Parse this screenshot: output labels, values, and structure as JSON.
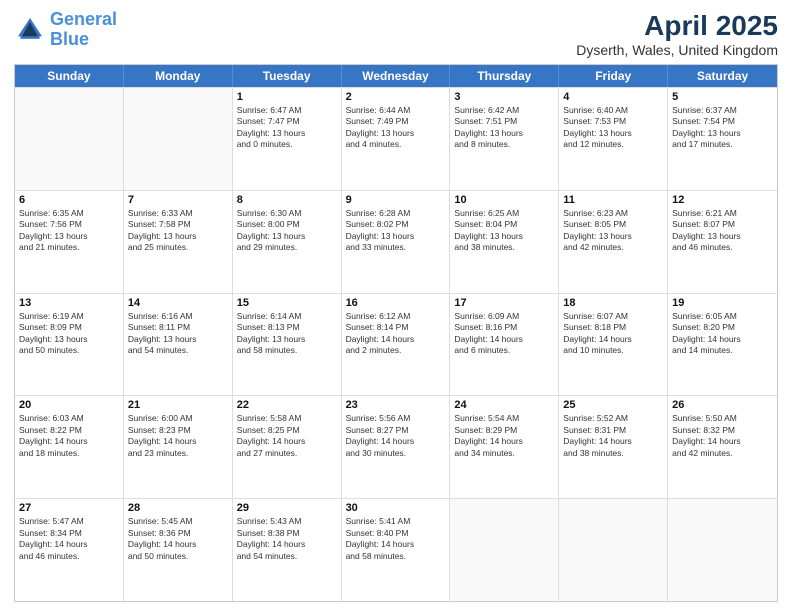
{
  "header": {
    "logo_general": "General",
    "logo_blue": "Blue",
    "title": "April 2025",
    "location": "Dyserth, Wales, United Kingdom"
  },
  "days_of_week": [
    "Sunday",
    "Monday",
    "Tuesday",
    "Wednesday",
    "Thursday",
    "Friday",
    "Saturday"
  ],
  "weeks": [
    [
      {
        "day": "",
        "empty": true
      },
      {
        "day": "",
        "empty": true
      },
      {
        "day": "1",
        "lines": [
          "Sunrise: 6:47 AM",
          "Sunset: 7:47 PM",
          "Daylight: 13 hours",
          "and 0 minutes."
        ]
      },
      {
        "day": "2",
        "lines": [
          "Sunrise: 6:44 AM",
          "Sunset: 7:49 PM",
          "Daylight: 13 hours",
          "and 4 minutes."
        ]
      },
      {
        "day": "3",
        "lines": [
          "Sunrise: 6:42 AM",
          "Sunset: 7:51 PM",
          "Daylight: 13 hours",
          "and 8 minutes."
        ]
      },
      {
        "day": "4",
        "lines": [
          "Sunrise: 6:40 AM",
          "Sunset: 7:53 PM",
          "Daylight: 13 hours",
          "and 12 minutes."
        ]
      },
      {
        "day": "5",
        "lines": [
          "Sunrise: 6:37 AM",
          "Sunset: 7:54 PM",
          "Daylight: 13 hours",
          "and 17 minutes."
        ]
      }
    ],
    [
      {
        "day": "6",
        "lines": [
          "Sunrise: 6:35 AM",
          "Sunset: 7:56 PM",
          "Daylight: 13 hours",
          "and 21 minutes."
        ]
      },
      {
        "day": "7",
        "lines": [
          "Sunrise: 6:33 AM",
          "Sunset: 7:58 PM",
          "Daylight: 13 hours",
          "and 25 minutes."
        ]
      },
      {
        "day": "8",
        "lines": [
          "Sunrise: 6:30 AM",
          "Sunset: 8:00 PM",
          "Daylight: 13 hours",
          "and 29 minutes."
        ]
      },
      {
        "day": "9",
        "lines": [
          "Sunrise: 6:28 AM",
          "Sunset: 8:02 PM",
          "Daylight: 13 hours",
          "and 33 minutes."
        ]
      },
      {
        "day": "10",
        "lines": [
          "Sunrise: 6:25 AM",
          "Sunset: 8:04 PM",
          "Daylight: 13 hours",
          "and 38 minutes."
        ]
      },
      {
        "day": "11",
        "lines": [
          "Sunrise: 6:23 AM",
          "Sunset: 8:05 PM",
          "Daylight: 13 hours",
          "and 42 minutes."
        ]
      },
      {
        "day": "12",
        "lines": [
          "Sunrise: 6:21 AM",
          "Sunset: 8:07 PM",
          "Daylight: 13 hours",
          "and 46 minutes."
        ]
      }
    ],
    [
      {
        "day": "13",
        "lines": [
          "Sunrise: 6:19 AM",
          "Sunset: 8:09 PM",
          "Daylight: 13 hours",
          "and 50 minutes."
        ]
      },
      {
        "day": "14",
        "lines": [
          "Sunrise: 6:16 AM",
          "Sunset: 8:11 PM",
          "Daylight: 13 hours",
          "and 54 minutes."
        ]
      },
      {
        "day": "15",
        "lines": [
          "Sunrise: 6:14 AM",
          "Sunset: 8:13 PM",
          "Daylight: 13 hours",
          "and 58 minutes."
        ]
      },
      {
        "day": "16",
        "lines": [
          "Sunrise: 6:12 AM",
          "Sunset: 8:14 PM",
          "Daylight: 14 hours",
          "and 2 minutes."
        ]
      },
      {
        "day": "17",
        "lines": [
          "Sunrise: 6:09 AM",
          "Sunset: 8:16 PM",
          "Daylight: 14 hours",
          "and 6 minutes."
        ]
      },
      {
        "day": "18",
        "lines": [
          "Sunrise: 6:07 AM",
          "Sunset: 8:18 PM",
          "Daylight: 14 hours",
          "and 10 minutes."
        ]
      },
      {
        "day": "19",
        "lines": [
          "Sunrise: 6:05 AM",
          "Sunset: 8:20 PM",
          "Daylight: 14 hours",
          "and 14 minutes."
        ]
      }
    ],
    [
      {
        "day": "20",
        "lines": [
          "Sunrise: 6:03 AM",
          "Sunset: 8:22 PM",
          "Daylight: 14 hours",
          "and 18 minutes."
        ]
      },
      {
        "day": "21",
        "lines": [
          "Sunrise: 6:00 AM",
          "Sunset: 8:23 PM",
          "Daylight: 14 hours",
          "and 23 minutes."
        ]
      },
      {
        "day": "22",
        "lines": [
          "Sunrise: 5:58 AM",
          "Sunset: 8:25 PM",
          "Daylight: 14 hours",
          "and 27 minutes."
        ]
      },
      {
        "day": "23",
        "lines": [
          "Sunrise: 5:56 AM",
          "Sunset: 8:27 PM",
          "Daylight: 14 hours",
          "and 30 minutes."
        ]
      },
      {
        "day": "24",
        "lines": [
          "Sunrise: 5:54 AM",
          "Sunset: 8:29 PM",
          "Daylight: 14 hours",
          "and 34 minutes."
        ]
      },
      {
        "day": "25",
        "lines": [
          "Sunrise: 5:52 AM",
          "Sunset: 8:31 PM",
          "Daylight: 14 hours",
          "and 38 minutes."
        ]
      },
      {
        "day": "26",
        "lines": [
          "Sunrise: 5:50 AM",
          "Sunset: 8:32 PM",
          "Daylight: 14 hours",
          "and 42 minutes."
        ]
      }
    ],
    [
      {
        "day": "27",
        "lines": [
          "Sunrise: 5:47 AM",
          "Sunset: 8:34 PM",
          "Daylight: 14 hours",
          "and 46 minutes."
        ]
      },
      {
        "day": "28",
        "lines": [
          "Sunrise: 5:45 AM",
          "Sunset: 8:36 PM",
          "Daylight: 14 hours",
          "and 50 minutes."
        ]
      },
      {
        "day": "29",
        "lines": [
          "Sunrise: 5:43 AM",
          "Sunset: 8:38 PM",
          "Daylight: 14 hours",
          "and 54 minutes."
        ]
      },
      {
        "day": "30",
        "lines": [
          "Sunrise: 5:41 AM",
          "Sunset: 8:40 PM",
          "Daylight: 14 hours",
          "and 58 minutes."
        ]
      },
      {
        "day": "",
        "empty": true
      },
      {
        "day": "",
        "empty": true
      },
      {
        "day": "",
        "empty": true
      }
    ]
  ]
}
